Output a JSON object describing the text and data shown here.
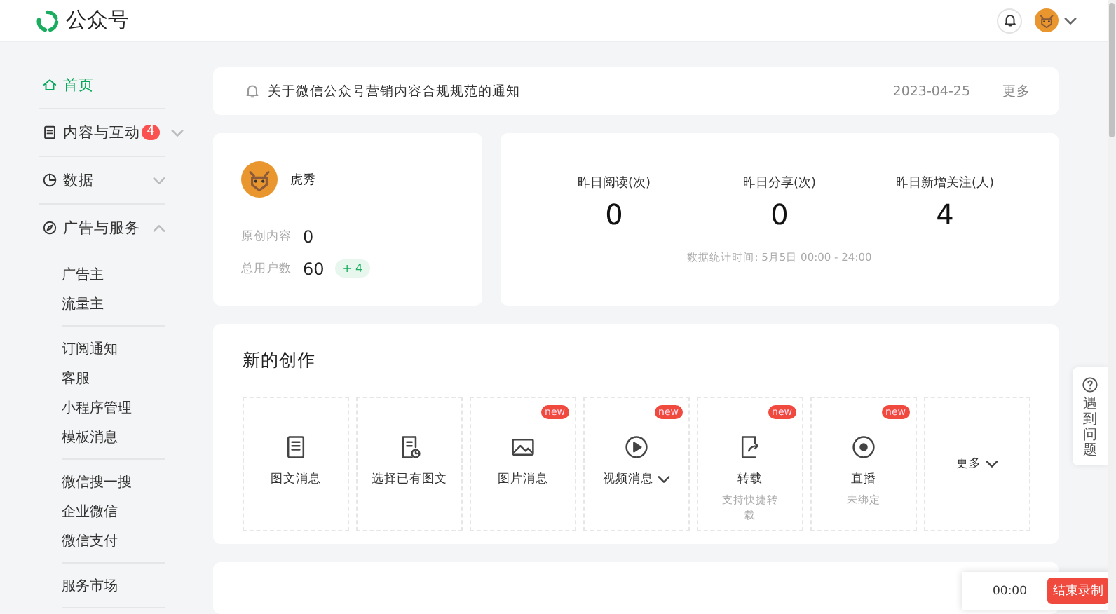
{
  "header": {
    "title": "公众号"
  },
  "sidebar": {
    "items": [
      {
        "label": "首页",
        "kind": "link",
        "selected": true
      },
      {
        "label": "内容与互动",
        "kind": "group",
        "selected": false,
        "expanded": false,
        "badge": "4"
      },
      {
        "label": "数据",
        "kind": "group",
        "selected": false,
        "expanded": false
      },
      {
        "label": "广告与服务",
        "kind": "group",
        "selected": false,
        "expanded": true,
        "sections": [
          {
            "items": [
              "广告主",
              "流量主"
            ]
          },
          {
            "items": [
              "订阅通知",
              "客服",
              "小程序管理",
              "模板消息"
            ]
          },
          {
            "items": [
              "微信搜一搜",
              "企业微信",
              "微信支付"
            ]
          },
          {
            "items": [
              "服务市场"
            ]
          }
        ]
      }
    ]
  },
  "notice": {
    "text": "关于微信公众号营销内容合规规范的通知",
    "date": "2023-04-25",
    "more": "更多"
  },
  "account": {
    "name": "虎秀",
    "stats": [
      {
        "label": "原创内容",
        "value": "0"
      },
      {
        "label": "总用户数",
        "value": "60",
        "delta": "+ 4"
      }
    ]
  },
  "overview": {
    "metrics": [
      {
        "label": "昨日阅读(次)",
        "value": "0"
      },
      {
        "label": "昨日分享(次)",
        "value": "0"
      },
      {
        "label": "昨日新增关注(人)",
        "value": "4"
      }
    ],
    "footnote": "数据统计时间: 5月5日 00:00 - 24:00"
  },
  "create": {
    "title": "新的创作",
    "tiles": [
      {
        "kind": "article",
        "label": "图文消息"
      },
      {
        "kind": "existing",
        "label": "选择已有图文"
      },
      {
        "kind": "image",
        "label": "图片消息",
        "badge": "new"
      },
      {
        "kind": "video",
        "label": "视频消息",
        "badge": "new",
        "dropdown": true
      },
      {
        "kind": "repost",
        "label": "转载",
        "badge": "new",
        "sub": "支持快捷转载"
      },
      {
        "kind": "live",
        "label": "直播",
        "badge": "new",
        "sub": "未绑定"
      },
      {
        "kind": "more",
        "label": "更多",
        "dropdown": true
      }
    ]
  },
  "help": {
    "text": "遇到问题"
  },
  "recorder": {
    "time": "00:00",
    "button": "结束录制"
  }
}
